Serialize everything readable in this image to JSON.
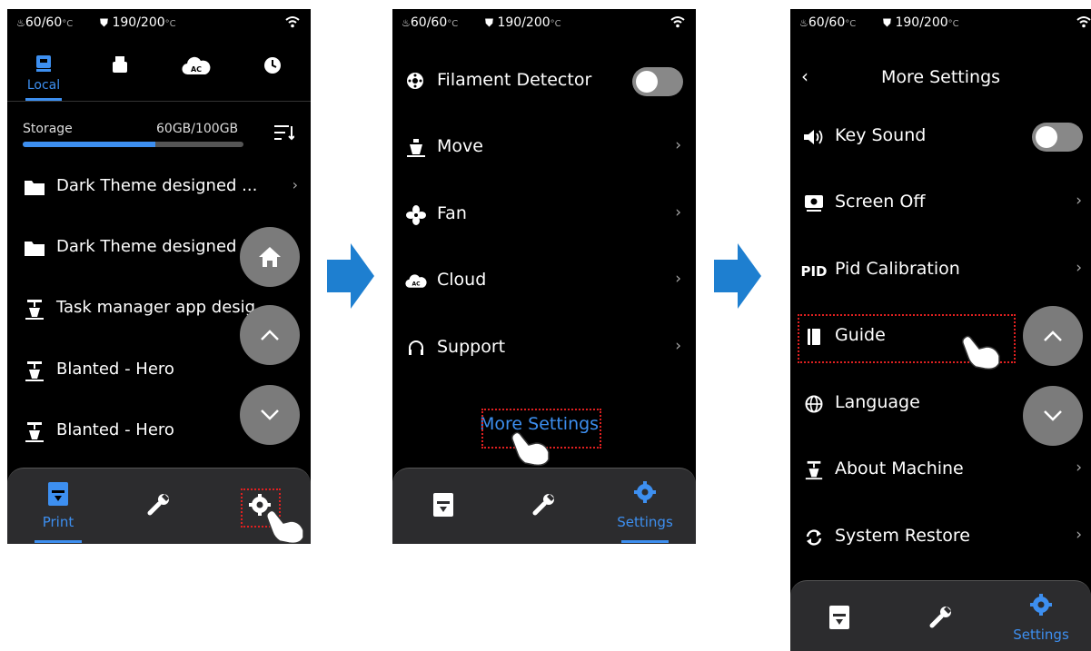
{
  "status": {
    "bed_temp": "60/60",
    "nozzle_temp": "190/200",
    "unit": "°C"
  },
  "screen1": {
    "tabs": [
      {
        "label": "Local"
      }
    ],
    "storage": {
      "label": "Storage",
      "value": "60GB/100GB",
      "used_fraction": 0.6
    },
    "files": [
      {
        "name": "Dark Theme designed ...",
        "type": "folder"
      },
      {
        "name": "Dark Theme designed ...",
        "type": "folder"
      },
      {
        "name": "Task manager app desig",
        "type": "model"
      },
      {
        "name": "Blanted - Hero",
        "type": "model"
      },
      {
        "name": "Blanted - Hero",
        "type": "model"
      }
    ],
    "nav": {
      "print_label": "Print"
    }
  },
  "screen2": {
    "menu": [
      {
        "label": "Filament Detector"
      },
      {
        "label": "Move"
      },
      {
        "label": "Fan"
      },
      {
        "label": "Cloud"
      },
      {
        "label": "Support"
      }
    ],
    "more_settings": "More Settings",
    "nav": {
      "settings_label": "Settings"
    }
  },
  "screen3": {
    "title": "More Settings",
    "menu": [
      {
        "label": "Key Sound",
        "icon_text": ""
      },
      {
        "label": "Screen Off",
        "icon_text": ""
      },
      {
        "label": "Pid Calibration",
        "icon_text": "PID"
      },
      {
        "label": "Guide",
        "icon_text": ""
      },
      {
        "label": "Language",
        "icon_text": ""
      },
      {
        "label": "About Machine",
        "icon_text": ""
      },
      {
        "label": "System Restore",
        "icon_text": ""
      }
    ],
    "nav": {
      "settings_label": "Settings"
    }
  },
  "colors": {
    "accent": "#3d8ff0",
    "highlight": "#e02020",
    "flow_arrow": "#1e7fd0",
    "screen_bg": "#000000",
    "nav_bg": "#2c2c2e"
  }
}
